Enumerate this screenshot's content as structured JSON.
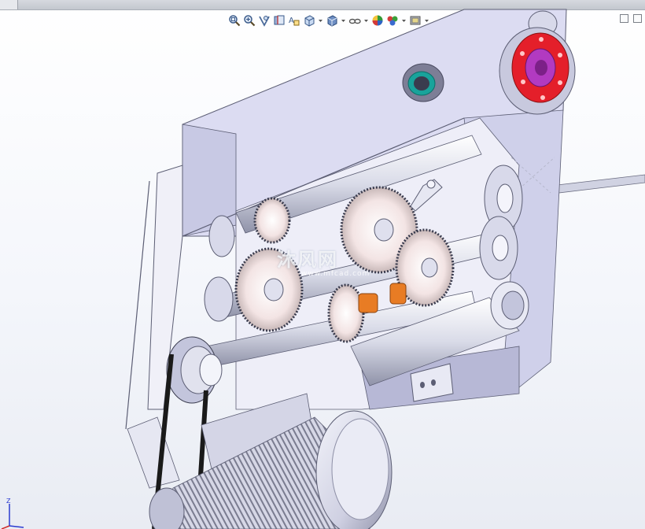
{
  "toolbar": {
    "icons": [
      "zoom-to-fit-icon",
      "zoom-area-icon",
      "previous-view-icon",
      "section-view-icon",
      "dynamic-annotation-icon",
      "view-orientation-icon",
      "display-style-icon",
      "hide-show-items-icon",
      "edit-appearance-icon",
      "apply-scene-icon",
      "view-settings-icon"
    ]
  },
  "watermark": {
    "text": "沐风网",
    "url": "www.mfcad.com"
  },
  "triad": {
    "axis_label": "Z"
  },
  "colors": {
    "housing": "#dcdcf2",
    "housing_shade": "#b7b8d6",
    "gear": "#f2e4e4",
    "flange_red": "#e41f2a",
    "flange_hub": "#b23ac1",
    "bushing_orange": "#e87c24",
    "seal_teal": "#19a39b"
  }
}
